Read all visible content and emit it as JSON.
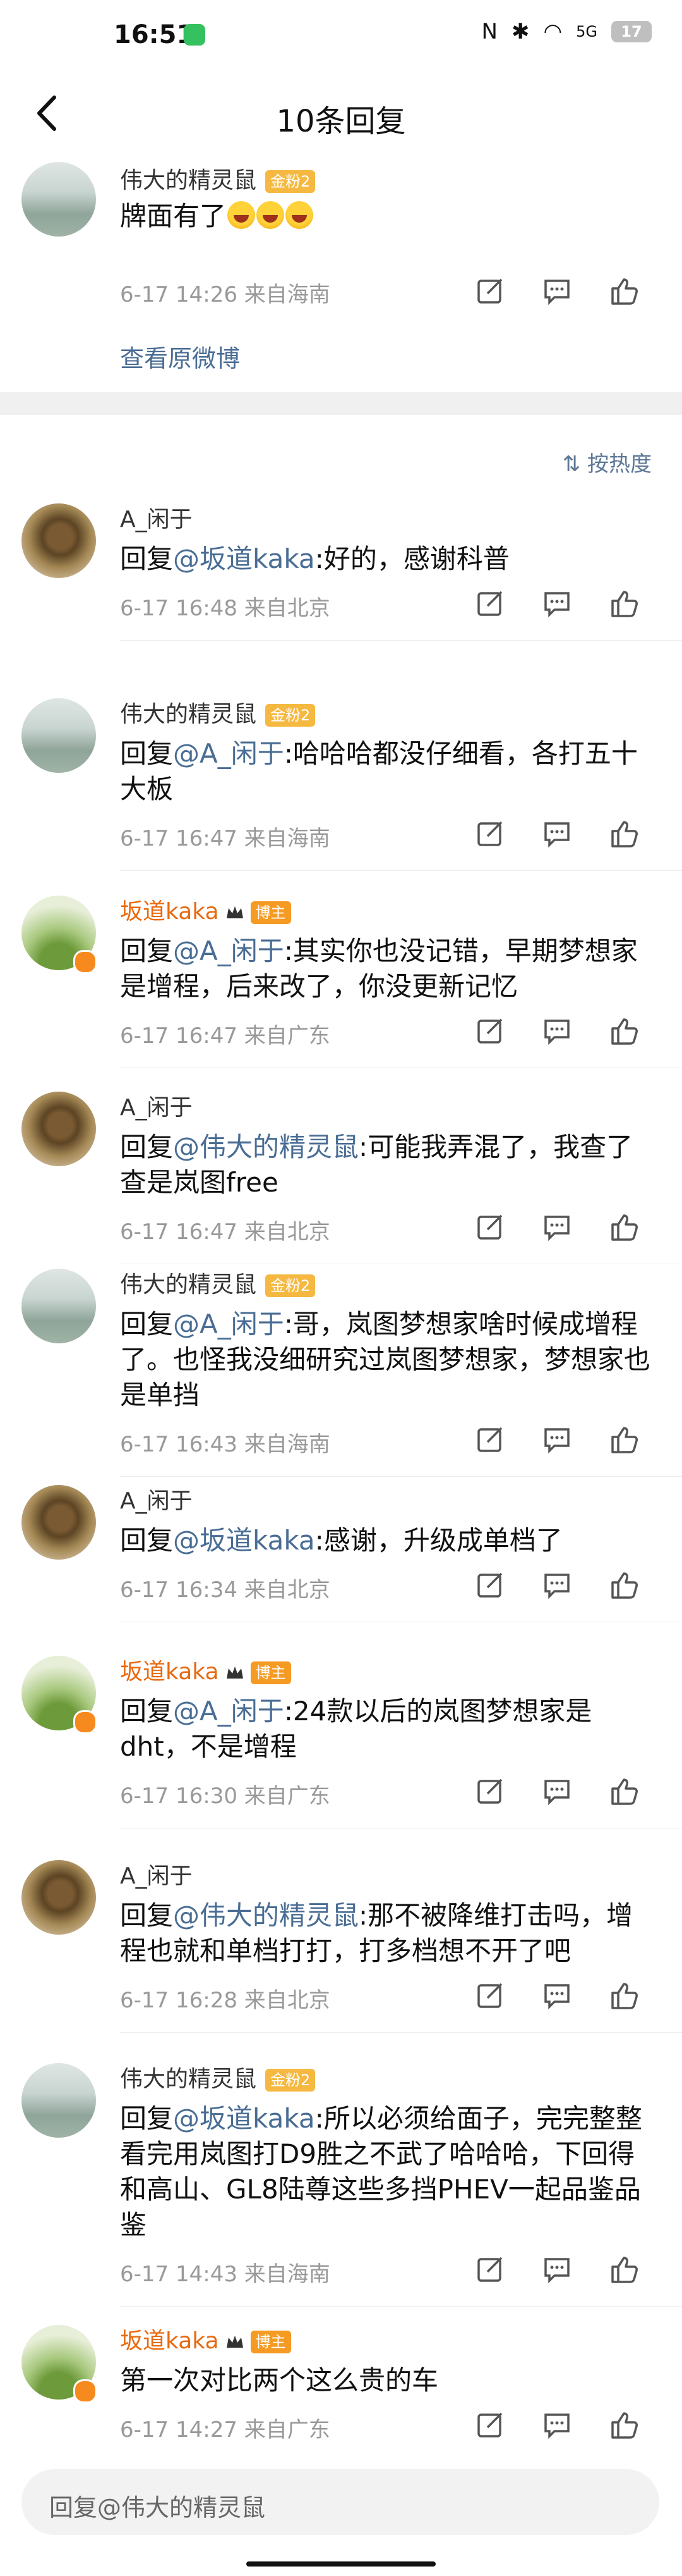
{
  "status_bar": {
    "time": "16:51",
    "signal_label": "5G",
    "battery": "17"
  },
  "nav": {
    "title": "10条回复"
  },
  "main_post": {
    "name": "伟大的精灵鼠",
    "badge": "金粉2",
    "text": "牌面有了",
    "meta": "6-17 14:26  来自海南",
    "view_original": "查看原微博"
  },
  "sort_label": "按热度",
  "comments": [
    {
      "name": "A_闲于",
      "prefix": "回复",
      "mention": "@坂道kaka",
      "text": ":好的，感谢科普",
      "meta": "6-17 16:48  来自北京"
    },
    {
      "name": "伟大的精灵鼠",
      "badge": "金粉2",
      "prefix": "回复",
      "mention": "@A_闲于",
      "text": ":哈哈哈都没仔细看，各打五十大板",
      "meta": "6-17 16:47  来自海南"
    },
    {
      "name": "坂道kaka",
      "badge": "博主",
      "prefix": "回复",
      "mention": "@A_闲于",
      "text": ":其实你也没记错，早期梦想家是增程，后来改了，你没更新记忆",
      "meta": "6-17 16:47  来自广东"
    },
    {
      "name": "A_闲于",
      "prefix": "回复",
      "mention": "@伟大的精灵鼠",
      "text": ":可能我弄混了，我查了查是岚图free",
      "meta": "6-17 16:47  来自北京"
    },
    {
      "name": "伟大的精灵鼠",
      "badge": "金粉2",
      "prefix": "回复",
      "mention": "@A_闲于",
      "text": ":哥，岚图梦想家啥时候成增程了。也怪我没细研究过岚图梦想家，梦想家也是单挡",
      "meta": "6-17 16:43  来自海南"
    },
    {
      "name": "A_闲于",
      "prefix": "回复",
      "mention": "@坂道kaka",
      "text": ":感谢，升级成单档了",
      "meta": "6-17 16:34  来自北京"
    },
    {
      "name": "坂道kaka",
      "badge": "博主",
      "prefix": "回复",
      "mention": "@A_闲于",
      "text": ":24款以后的岚图梦想家是dht，不是增程",
      "meta": "6-17 16:30  来自广东"
    },
    {
      "name": "A_闲于",
      "prefix": "回复",
      "mention": "@伟大的精灵鼠",
      "text": ":那不被降维打击吗，增程也就和单档打打，打多档想不开了吧",
      "meta": "6-17 16:28  来自北京"
    },
    {
      "name": "伟大的精灵鼠",
      "badge": "金粉2",
      "prefix": "回复",
      "mention": "@坂道kaka",
      "text": ":所以必须给面子，完完整整看完用岚图打D9胜之不武了哈哈哈，下回得和高山、GL8陆尊这些多挡PHEV一起品鉴品鉴",
      "meta": "6-17 14:43  来自海南"
    },
    {
      "name": "坂道kaka",
      "badge": "博主",
      "prefix": "",
      "mention": "",
      "text": "第一次对比两个这么贵的车",
      "meta": "6-17 14:27  来自广东"
    }
  ],
  "reply_placeholder": "回复@伟大的精灵鼠",
  "colors": {
    "mention": "#4a6d94",
    "blogger_name": "#e86a10",
    "fan_badge": "#f5b942",
    "meta": "#999999"
  }
}
